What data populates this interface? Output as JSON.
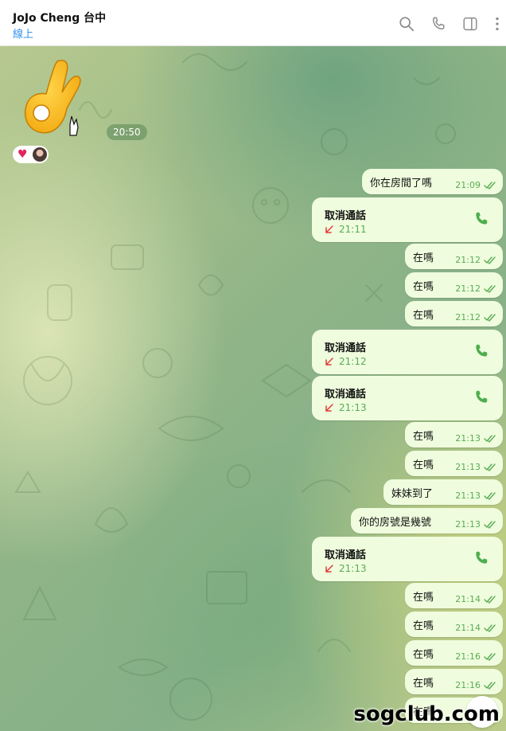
{
  "header": {
    "title": "JoJo Cheng 台中",
    "status": "線上",
    "icons": [
      "search-icon",
      "phone-icon",
      "sidebar-icon",
      "more-vertical-icon"
    ]
  },
  "sticker": {
    "emoji": "👌",
    "time": "20:50",
    "reaction": "♥"
  },
  "messages": [
    {
      "type": "text",
      "text": "你在房間了嗎",
      "time": "21:09"
    },
    {
      "type": "call",
      "title": "取消通話",
      "time": "21:11"
    },
    {
      "type": "text",
      "text": "在嗎",
      "time": "21:12"
    },
    {
      "type": "text",
      "text": "在嗎",
      "time": "21:12"
    },
    {
      "type": "text",
      "text": "在嗎",
      "time": "21:12"
    },
    {
      "type": "call",
      "title": "取消通話",
      "time": "21:12"
    },
    {
      "type": "call",
      "title": "取消通話",
      "time": "21:13"
    },
    {
      "type": "text",
      "text": "在嗎",
      "time": "21:13"
    },
    {
      "type": "text",
      "text": "在嗎",
      "time": "21:13"
    },
    {
      "type": "text",
      "text": "妹妹到了",
      "time": "21:13"
    },
    {
      "type": "text",
      "text": "你的房號是幾號",
      "time": "21:13"
    },
    {
      "type": "call",
      "title": "取消通話",
      "time": "21:13"
    },
    {
      "type": "text",
      "text": "在嗎",
      "time": "21:14"
    },
    {
      "type": "text",
      "text": "在嗎",
      "time": "21:14"
    },
    {
      "type": "text",
      "text": "在嗎",
      "time": "21:16"
    },
    {
      "type": "text",
      "text": "在嗎",
      "time": "21:16"
    },
    {
      "type": "text",
      "text": "在嗎",
      "time": ""
    }
  ],
  "watermark": "sogclub.com",
  "colors": {
    "accent": "#3390ec",
    "bubble": "#effdde",
    "time": "#5aab55",
    "missed": "#e53935",
    "call_icon": "#4fae4e"
  }
}
